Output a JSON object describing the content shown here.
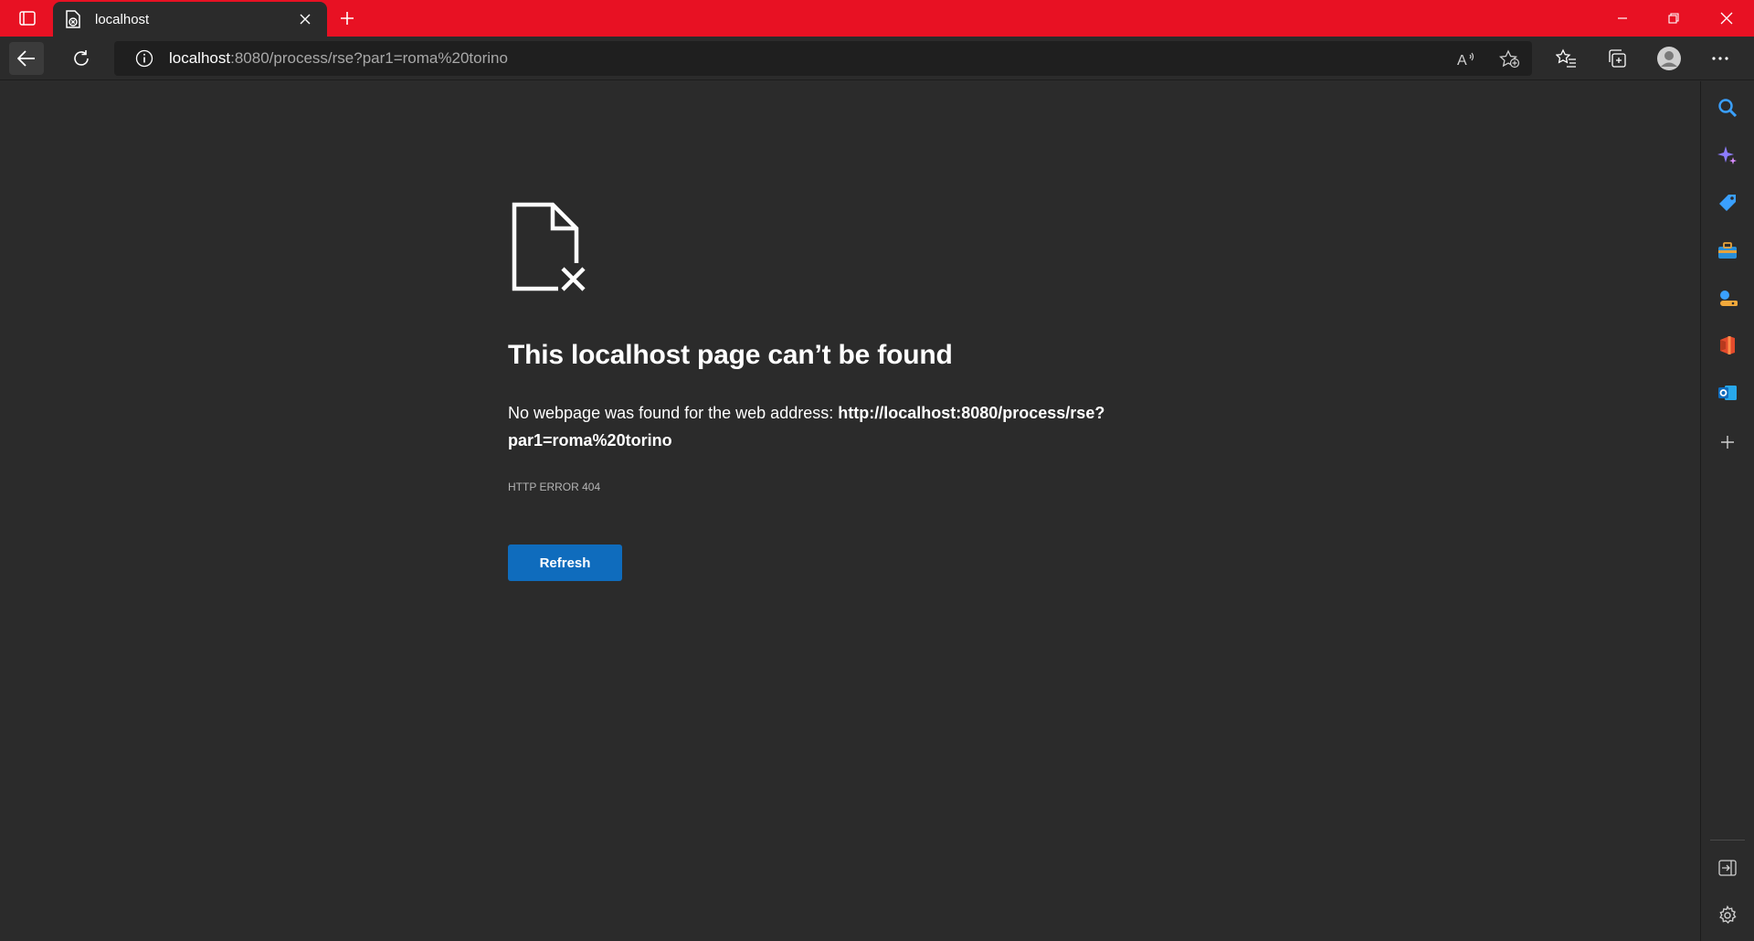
{
  "tab": {
    "title": "localhost"
  },
  "address": {
    "host": "localhost",
    "rest": ":8080/process/rse?par1=roma%20torino"
  },
  "error": {
    "title": "This localhost page can’t be found",
    "desc_prefix": "No webpage was found for the web address: ",
    "desc_url": "http://localhost:8080/process/rse?par1=roma%20torino",
    "code": "HTTP ERROR 404",
    "refresh_label": "Refresh"
  },
  "toolbar": {
    "read_aloud_label": "A"
  },
  "colors": {
    "titlebar": "#e81123",
    "accent": "#0f6cbd",
    "background": "#2b2b2b"
  },
  "sidebar": {
    "items": [
      "search-icon",
      "copilot-icon",
      "shopping-icon",
      "tools-icon",
      "games-icon",
      "office-icon",
      "outlook-icon",
      "add-icon"
    ],
    "bottom": [
      "hide-sidebar-icon",
      "settings-icon"
    ]
  }
}
